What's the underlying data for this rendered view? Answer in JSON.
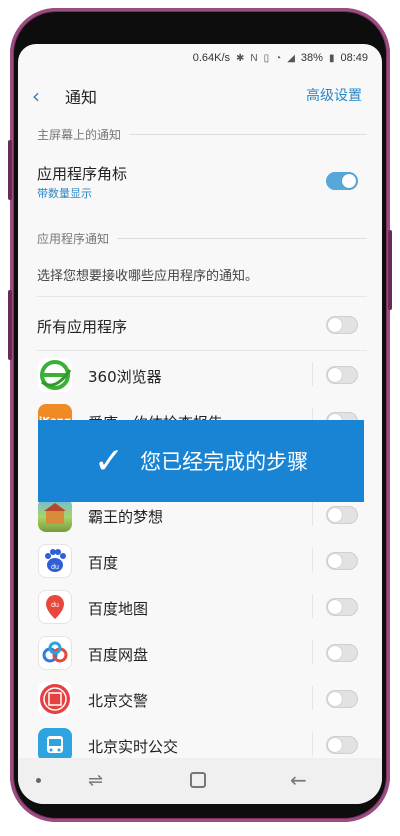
{
  "status_bar": {
    "speed": "0.64K/s",
    "battery": "38%",
    "time": "08:49",
    "icons": [
      "bluetooth-icon",
      "nfc-icon",
      "vibrate-icon",
      "wifi-icon",
      "signal-icon",
      "battery-icon"
    ]
  },
  "header": {
    "title": "通知",
    "action": "高级设置"
  },
  "home_screen_section": {
    "label": "主屏幕上的通知",
    "badge_title": "应用程序角标",
    "badge_subtitle": "带数量显示",
    "badge_enabled": true
  },
  "app_notif_section": {
    "label": "应用程序通知",
    "description": "选择您想要接收哪些应用程序的通知。",
    "all_apps_label": "所有应用程序",
    "all_apps_enabled": false
  },
  "apps": [
    {
      "name": "360浏览器",
      "enabled": false,
      "icon": "360-browser-icon"
    },
    {
      "name": "爱康 - 约体检查报告",
      "enabled": false,
      "icon": "ikang-icon"
    },
    {
      "name": "霸王的梦想",
      "enabled": false,
      "icon": "game-icon"
    },
    {
      "name": "百度",
      "enabled": false,
      "icon": "baidu-icon"
    },
    {
      "name": "百度地图",
      "enabled": false,
      "icon": "baidu-map-icon"
    },
    {
      "name": "百度网盘",
      "enabled": false,
      "icon": "baidu-netdisk-icon"
    },
    {
      "name": "北京交警",
      "enabled": false,
      "icon": "beijing-police-icon"
    },
    {
      "name": "北京实时公交",
      "enabled": false,
      "icon": "beijing-bus-icon"
    }
  ],
  "banner": {
    "text": "您已经完成的步骤"
  },
  "colors": {
    "accent": "#2b88c6",
    "banner": "#1a84d4",
    "toggle_on": "#57a8d8"
  }
}
